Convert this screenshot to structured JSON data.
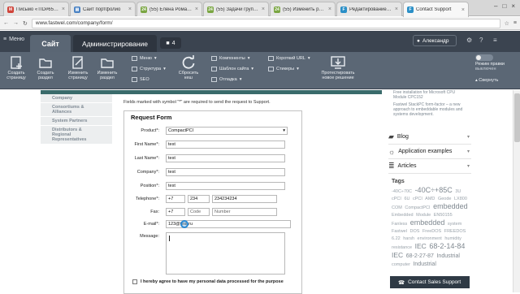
{
  "browser": {
    "tabs": [
      {
        "label": "Письмо «TID#654...",
        "icon": "mail-icon",
        "color": "#d0443a"
      },
      {
        "label": "Сайт портфолио",
        "icon": "doc-icon",
        "color": "#4b83c4"
      },
      {
        "label": "(55) Елена Роман...",
        "icon": "jira-icon",
        "color": "#7aa642"
      },
      {
        "label": "(55) Задачи группы",
        "icon": "jira-icon",
        "color": "#7aa642"
      },
      {
        "label": "(55) Изменить рас...",
        "icon": "jira-icon",
        "color": "#7aa642"
      },
      {
        "label": "Редактирование п...",
        "icon": "bitrix-icon",
        "color": "#2a8fc7"
      },
      {
        "label": "Contact Support",
        "icon": "bitrix-icon",
        "color": "#2a8fc7"
      }
    ],
    "url": "www.fastwel.com/company/form/"
  },
  "admin": {
    "menu_label": "Меню",
    "tab_site": "Сайт",
    "tab_admin": "Администрирование",
    "notif_count": "4",
    "user_name": "Александр"
  },
  "toolbar": {
    "buttons": [
      {
        "line1": "Создать",
        "line2": "страницу"
      },
      {
        "line1": "Создать",
        "line2": "раздел"
      },
      {
        "line1": "Изменить",
        "line2": "страницу"
      },
      {
        "line1": "Изменить",
        "line2": "раздел"
      }
    ],
    "small_a": [
      "Меню",
      "Структура",
      "SEO"
    ],
    "reset": {
      "line1": "Сбросить",
      "line2": "кеш"
    },
    "small_b": [
      "Компоненты",
      "Шаблон сайта",
      "Отладка"
    ],
    "small_c": [
      "Короткий URL",
      "Стикеры"
    ],
    "test": {
      "line1": "Протестировать",
      "line2": "новое решение"
    },
    "edit_mode": {
      "label": "Режим правки",
      "state": "выключен"
    },
    "collapse": "Свернуть"
  },
  "left_nav": [
    "Company",
    "Consortiums & Alliances",
    "System Partners",
    "Distributors & Regional Representatives"
  ],
  "form": {
    "note": "Fields marked with symbol \"*\" are required to send the request to Support.",
    "title": "Request Form",
    "product_label": "Product*:",
    "product_value": "CompactPCI",
    "first_name_label": "First Name*:",
    "first_name_value": "test",
    "last_name_label": "Last Name*:",
    "last_name_value": "test",
    "company_label": "Company*:",
    "company_value": "test",
    "position_label": "Position*:",
    "position_value": "test",
    "telephone_label": "Telephone*:",
    "tel_code": "+7",
    "tel_area": "234",
    "tel_number": "234234234",
    "fax_label": "Fax:",
    "fax_code": "+7",
    "fax_area": "Code",
    "fax_number": "Number",
    "email_label": "E-mail*:",
    "email_value": "123@test.ru",
    "message_label": "Message:",
    "agree_text": "I hereby agree to have my personal data processed for the purpose"
  },
  "right": {
    "intro_lines": [
      "Free installation for Microsoft CPU",
      "Module CPC152",
      "Fastwel StackPC form-factor – a new",
      "approach to embeddable modules and",
      "systems development."
    ],
    "items": [
      {
        "label": "Blog",
        "icon": "chat-icon"
      },
      {
        "label": "Application examples",
        "icon": "bulb-icon"
      },
      {
        "label": "Articles",
        "icon": "books-icon"
      }
    ],
    "tags_title": "Tags",
    "tags": [
      "-40C÷70C",
      "-40C÷+85C",
      "3U",
      "cPCI",
      "6U",
      "cPCI",
      "AMD",
      "Geode",
      "LX800",
      "COM",
      "CompactPCI",
      "embedded",
      "Embedded",
      "Module",
      "EN50155",
      "Fanless",
      "embedded",
      "system",
      "Fastwel",
      "DOS",
      "FreeDOS",
      "FREEDOS",
      "6.22",
      "harsh",
      "environment",
      "humidity",
      "resistance",
      "IEC",
      "68-2-14-84",
      "IEC",
      "68-2-27-87",
      "Industrial",
      "computer",
      "Industrial"
    ],
    "contact_sales": "Contact Sales Support"
  }
}
